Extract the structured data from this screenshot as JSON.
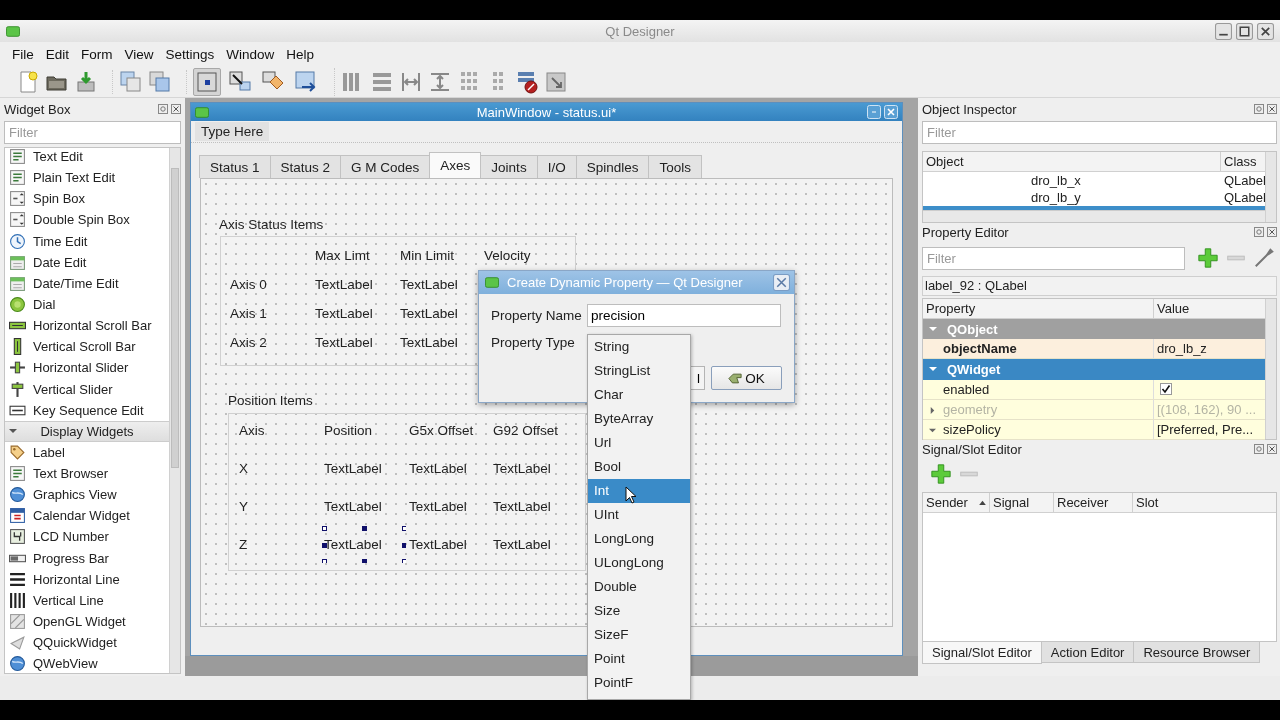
{
  "window": {
    "title": "Qt Designer"
  },
  "menu": [
    "File",
    "Edit",
    "Form",
    "View",
    "Settings",
    "Window",
    "Help"
  ],
  "toolbar_modes": [
    {
      "selected": true
    },
    {
      "selected": false
    },
    {
      "selected": false
    },
    {
      "selected": false
    }
  ],
  "widget_box": {
    "title": "Widget Box",
    "filter_placeholder": "Filter",
    "items": [
      {
        "kind": "widget",
        "label": "Text Edit"
      },
      {
        "kind": "widget",
        "label": "Plain Text Edit"
      },
      {
        "kind": "widget",
        "label": "Spin Box"
      },
      {
        "kind": "widget",
        "label": "Double Spin Box"
      },
      {
        "kind": "widget",
        "label": "Time Edit"
      },
      {
        "kind": "widget",
        "label": "Date Edit"
      },
      {
        "kind": "widget",
        "label": "Date/Time Edit"
      },
      {
        "kind": "widget",
        "label": "Dial"
      },
      {
        "kind": "widget",
        "label": "Horizontal Scroll Bar"
      },
      {
        "kind": "widget",
        "label": "Vertical Scroll Bar"
      },
      {
        "kind": "widget",
        "label": "Horizontal Slider"
      },
      {
        "kind": "widget",
        "label": "Vertical Slider"
      },
      {
        "kind": "widget",
        "label": "Key Sequence Edit"
      },
      {
        "kind": "category",
        "label": "Display Widgets",
        "expanded": true
      },
      {
        "kind": "widget",
        "label": "Label"
      },
      {
        "kind": "widget",
        "label": "Text Browser"
      },
      {
        "kind": "widget",
        "label": "Graphics View"
      },
      {
        "kind": "widget",
        "label": "Calendar Widget"
      },
      {
        "kind": "widget",
        "label": "LCD Number"
      },
      {
        "kind": "widget",
        "label": "Progress Bar"
      },
      {
        "kind": "widget",
        "label": "Horizontal Line"
      },
      {
        "kind": "widget",
        "label": "Vertical Line"
      },
      {
        "kind": "widget",
        "label": "OpenGL Widget"
      },
      {
        "kind": "widget",
        "label": "QQuickWidget"
      },
      {
        "kind": "widget",
        "label": "QWebView"
      }
    ]
  },
  "form_window": {
    "title": "MainWindow - status.ui*",
    "menu_placeholder": "Type Here",
    "tabs": [
      {
        "label": "Status 1",
        "selected": false
      },
      {
        "label": "Status 2",
        "selected": false
      },
      {
        "label": "G M Codes",
        "selected": false
      },
      {
        "label": "Axes",
        "selected": true
      },
      {
        "label": "Joints",
        "selected": false
      },
      {
        "label": "I/O",
        "selected": false
      },
      {
        "label": "Spindles",
        "selected": false
      },
      {
        "label": "Tools",
        "selected": false
      }
    ],
    "axis_status": {
      "title": "Axis Status Items",
      "header": [
        "Max Limt",
        "Min Limit",
        "Velocity"
      ],
      "rows": [
        {
          "axis": "Axis 0",
          "cells": [
            "TextLabel",
            "TextLabel"
          ]
        },
        {
          "axis": "Axis 1",
          "cells": [
            "TextLabel",
            "TextLabel"
          ]
        },
        {
          "axis": "Axis 2",
          "cells": [
            "TextLabel",
            "TextLabel"
          ]
        }
      ]
    },
    "position": {
      "title": "Position Items",
      "header": [
        "Axis",
        "Position",
        "G5x Offset",
        "G92 Offset"
      ],
      "rows": [
        {
          "axis": "X",
          "cells": [
            {
              "text": "TextLabel",
              "selected": false
            },
            {
              "text": "TextLabel",
              "selected": false
            },
            {
              "text": "TextLabel",
              "selected": false
            }
          ]
        },
        {
          "axis": "Y",
          "cells": [
            {
              "text": "TextLabel",
              "selected": false
            },
            {
              "text": "TextLabel",
              "selected": false
            },
            {
              "text": "TextLabel",
              "selected": false
            }
          ]
        },
        {
          "axis": "Z",
          "cells": [
            {
              "text": "TextLabel",
              "selected": true
            },
            {
              "text": "TextLabel",
              "selected": false
            },
            {
              "text": "TextLabel",
              "selected": false
            }
          ]
        }
      ]
    }
  },
  "dialog": {
    "title": "Create Dynamic Property — Qt Designer",
    "name_label": "Property Name",
    "name_value": "precision",
    "type_label": "Property Type",
    "cancel_fragment": "l",
    "ok": "OK"
  },
  "type_list": [
    {
      "label": "String",
      "selected": false
    },
    {
      "label": "StringList",
      "selected": false
    },
    {
      "label": "Char",
      "selected": false
    },
    {
      "label": "ByteArray",
      "selected": false
    },
    {
      "label": "Url",
      "selected": false
    },
    {
      "label": "Bool",
      "selected": false
    },
    {
      "label": "Int",
      "selected": true
    },
    {
      "label": "UInt",
      "selected": false
    },
    {
      "label": "LongLong",
      "selected": false
    },
    {
      "label": "ULongLong",
      "selected": false
    },
    {
      "label": "Double",
      "selected": false
    },
    {
      "label": "Size",
      "selected": false
    },
    {
      "label": "SizeF",
      "selected": false
    },
    {
      "label": "Point",
      "selected": false
    },
    {
      "label": "PointF",
      "selected": false
    }
  ],
  "object_inspector": {
    "title": "Object Inspector",
    "filter_placeholder": "Filter",
    "columns": [
      "Object",
      "Class"
    ],
    "rows": [
      {
        "object": "dro_lb_x",
        "class": "QLabel",
        "selected": false
      },
      {
        "object": "dro_lb_y",
        "class": "QLabel",
        "selected": false
      },
      {
        "selected": true
      }
    ]
  },
  "property_editor": {
    "title": "Property Editor",
    "filter_placeholder": "Filter",
    "object_label": "label_92 : QLabel",
    "columns": [
      "Property",
      "Value"
    ],
    "groups": [
      {
        "name": "QObject",
        "selected": false,
        "expanded": true,
        "children": [
          {
            "kind": "text",
            "name": "objectName",
            "value": "dro_lb_z",
            "modified": true,
            "disabled": false
          }
        ]
      },
      {
        "name": "QWidget",
        "selected": true,
        "expanded": true,
        "children": [
          {
            "kind": "checkbox",
            "name": "enabled",
            "checked": true,
            "modified": false,
            "disabled": false
          },
          {
            "kind": "text",
            "name": "geometry",
            "value": "[(108, 162), 90 ...",
            "modified": false,
            "disabled": true,
            "expanded": false
          },
          {
            "kind": "text",
            "name": "sizePolicy",
            "value": "[Preferred, Pre...",
            "modified": false,
            "disabled": false,
            "expanded": true
          }
        ]
      }
    ]
  },
  "signal_slot": {
    "title": "Signal/Slot Editor",
    "columns": [
      {
        "label": "Sender",
        "sorted": true
      },
      {
        "label": "Signal",
        "sorted": false
      },
      {
        "label": "Receiver",
        "sorted": false
      },
      {
        "label": "Slot",
        "sorted": false
      }
    ]
  },
  "bottom_tabs": [
    {
      "label": "Signal/Slot Editor",
      "selected": true
    },
    {
      "label": "Action Editor",
      "selected": false
    },
    {
      "label": "Resource Browser",
      "selected": false
    }
  ]
}
